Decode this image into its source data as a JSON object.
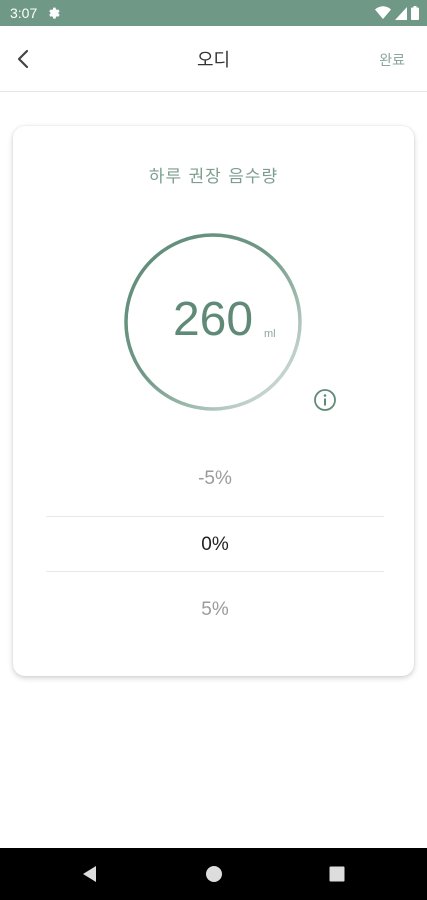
{
  "status_bar": {
    "time": "3:07",
    "background": "#6f9886",
    "icons": [
      "settings-gear-icon",
      "wifi-icon",
      "signal-icon",
      "battery-icon"
    ]
  },
  "app_bar": {
    "title": "오디",
    "done_label": "완료",
    "back_icon": "chevron-left-icon"
  },
  "card": {
    "title": "하루 권장 음수량",
    "value": "260",
    "unit": "ml",
    "accent": "#5f8a78",
    "info_icon": "info-icon"
  },
  "picker": {
    "options": [
      "-5%",
      "0%",
      "5%"
    ],
    "selected": "0%"
  },
  "nav_bar": {
    "icons": [
      "back-triangle-icon",
      "home-circle-icon",
      "recents-square-icon"
    ]
  }
}
